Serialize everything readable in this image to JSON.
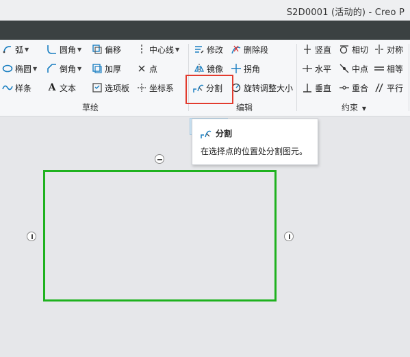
{
  "window": {
    "title": "S2D0001 (活动的) - Creo P"
  },
  "ribbon": {
    "sketch_group": {
      "label": "草绘",
      "tools": {
        "arc": "弧",
        "fillet": "圆角",
        "offset": "偏移",
        "centerline": "中心线",
        "ellipse": "椭圆",
        "chamfer": "倒角",
        "thicken": "加厚",
        "point": "点",
        "spline": "样条",
        "text": "文本",
        "palette": "选项板",
        "coordsys": "坐标系"
      }
    },
    "edit_group": {
      "label": "编辑",
      "tools": {
        "modify": "修改",
        "delete_segment": "删除段",
        "mirror": "镜像",
        "corner": "拐角",
        "divide": "分割",
        "rotate_resize": "旋转调整大小"
      }
    },
    "constrain_group": {
      "label": "约束",
      "tools": {
        "vertical": "竖直",
        "tangent": "相切",
        "symmetric": "对称",
        "horizontal": "水平",
        "midpoint": "中点",
        "equal": "相等",
        "perpendicular": "垂直",
        "coincident": "重合",
        "parallel": "平行"
      }
    }
  },
  "tooltip": {
    "title": "分割",
    "description": "在选择点的位置处分割图元。"
  },
  "colors": {
    "highlight": "#e23b2e",
    "sketch_line": "#1fb21f",
    "tab_strip": "#3b4142",
    "active_button": "#cfe6f6"
  }
}
